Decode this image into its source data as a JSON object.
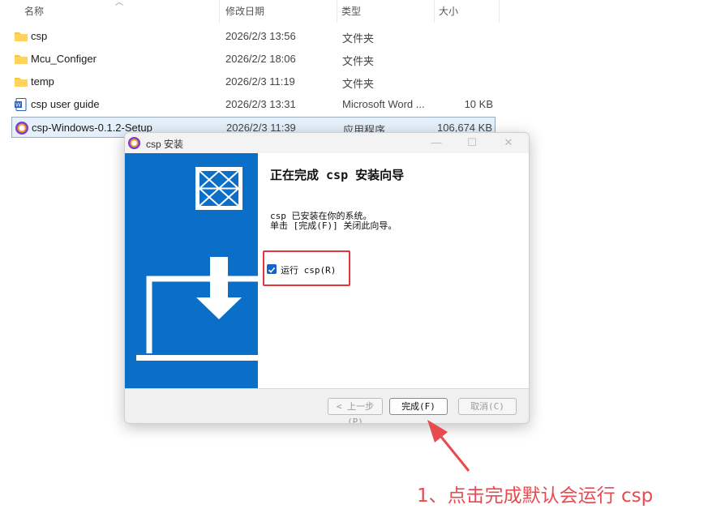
{
  "columns": {
    "name": "名称",
    "modified": "修改日期",
    "type": "类型",
    "size": "大小"
  },
  "files": [
    {
      "icon": "folder-icon",
      "name": "csp",
      "modified": "2026/2/3 13:56",
      "type": "文件夹",
      "size": ""
    },
    {
      "icon": "folder-icon",
      "name": "Mcu_Configer",
      "modified": "2026/2/2 18:06",
      "type": "文件夹",
      "size": ""
    },
    {
      "icon": "folder-icon",
      "name": "temp",
      "modified": "2026/2/3 11:19",
      "type": "文件夹",
      "size": ""
    },
    {
      "icon": "word-doc-icon",
      "name": "csp user guide",
      "modified": "2026/2/3 13:31",
      "type": "Microsoft Word ...",
      "size": "10 KB"
    },
    {
      "icon": "csp-app-icon",
      "name": "csp-Windows-0.1.2-Setup",
      "modified": "2026/2/3 11:39",
      "type": "应用程序",
      "size": "106,674 KB",
      "selected": true
    }
  ],
  "dialog": {
    "title": "csp 安装",
    "heading": "正在完成 csp 安装向导",
    "line1": "csp 已安装在你的系统。",
    "line2": "单击 [完成(F)] 关闭此向导。",
    "checkbox_label": "运行 csp(R)",
    "checkbox_checked": true,
    "buttons": {
      "back": "< 上一步(P)",
      "finish": "完成(F)",
      "cancel": "取消(C)"
    }
  },
  "annotation": "1、点击完成默认会运行 csp",
  "colors": {
    "accent_blue": "#0b6fc8",
    "highlight_red": "#e0363c",
    "annotation_red": "#e84a4f",
    "folder_yellow": "#f5c542"
  }
}
